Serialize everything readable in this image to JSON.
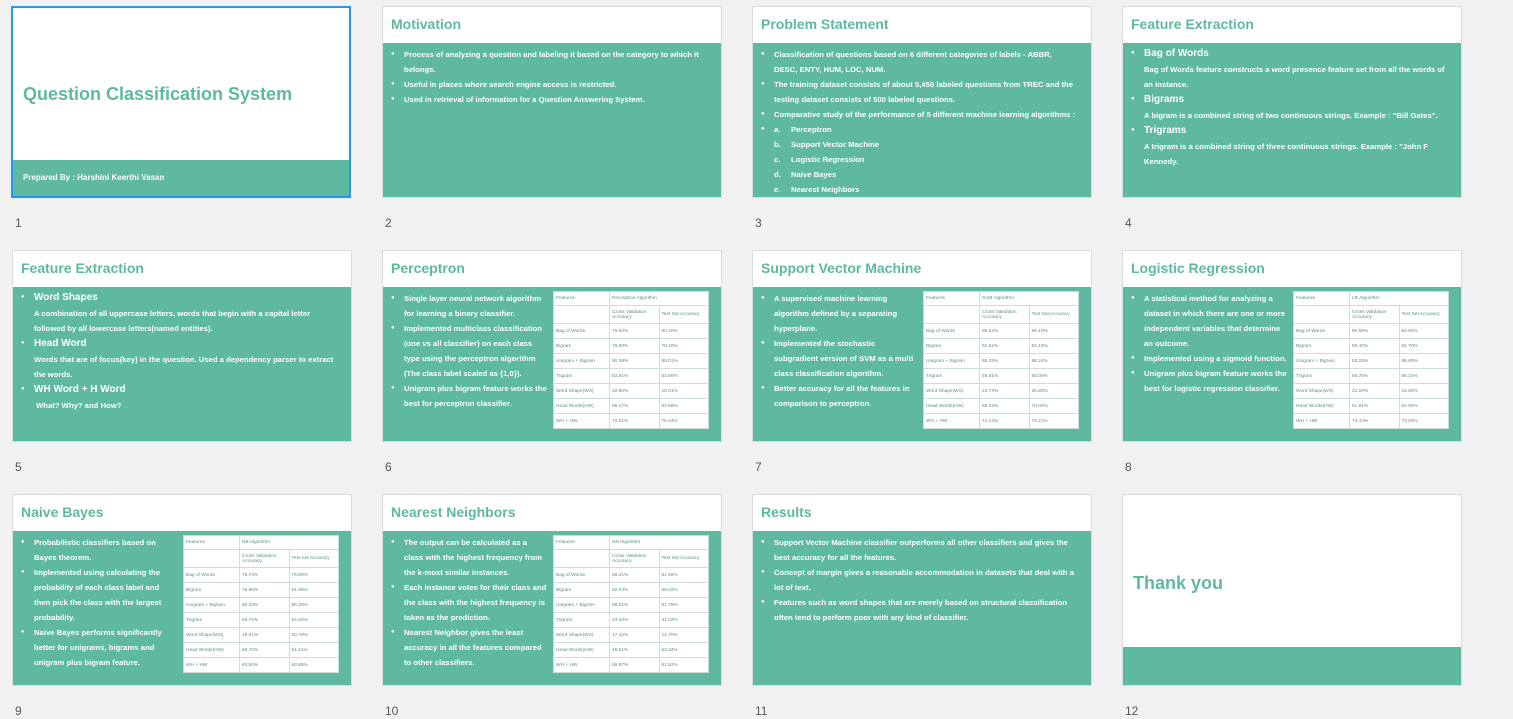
{
  "slides": [
    {
      "number": "1",
      "title": "Question Classification System",
      "author": "Prepared By : Harshini Keerthi Vasan"
    },
    {
      "number": "2",
      "title": "Motivation",
      "bullets": [
        "Process of analyzing a question and labeling it based on the category to which it belongs.",
        "Useful in places where search engine access is restricted.",
        "Used in retrieval of information for a Question Answering System."
      ]
    },
    {
      "number": "3",
      "title": "Problem Statement",
      "bullets": [
        "Classification of questions based on 6 different categories of labels - ABBR, DESC, ENTY, HUM, LOC, NUM.",
        "The training dataset consists of about 5,450 labeled questions from TREC and the testing dataset consists of 500 labeled questions.",
        "Comparative study of the performance of 5 different machine learning algorithms :"
      ],
      "algorithms": [
        {
          "letter": "a.",
          "name": "Perceptron"
        },
        {
          "letter": "b.",
          "name": "Support Vector Machine"
        },
        {
          "letter": "c.",
          "name": "Logistic Regression"
        },
        {
          "letter": "d.",
          "name": "Naive Bayes"
        },
        {
          "letter": "e.",
          "name": "Nearest Neighbors"
        }
      ]
    },
    {
      "number": "4",
      "title": "Feature Extraction",
      "features": [
        {
          "head": "Bag of Words",
          "desc": "Bag of Words feature constructs a word presence feature set from all the words of an instance."
        },
        {
          "head": "Bigrams",
          "desc": "A bigram is a combined string of two continuous strings. Example : \"Bill Gates\"."
        },
        {
          "head": "Trigrams",
          "desc": "A trigram is a combined string of three continuous strings. Example : \"John F Kennedy."
        }
      ]
    },
    {
      "number": "5",
      "title": "Feature Extraction",
      "features": [
        {
          "head": "Word Shapes",
          "desc": "A combination of all uppercase letters, words that begin with a capital letter followed by all lowercase letters(named entities)."
        },
        {
          "head": "Head Word",
          "desc": "Words that are of focus(key) in the question. Used a dependency parser to extract the words."
        },
        {
          "head": "WH Word + H Word",
          "desc": "What? Why? and How?"
        }
      ]
    },
    {
      "number": "6",
      "title": "Perceptron",
      "bullets": [
        "Single layer neural network algorithm for learning a binary classifier.",
        "Implemented multiclass classification (one vs all classifier) on each class type using the perceptron algorithm (The class label scaled as {1,0}).",
        "Unigram plus bigram feature works the best for perceptron classifier."
      ],
      "table": {
        "algo": "Perceptron Algorithm",
        "rows": [
          [
            "Bag of Words",
            "76.50%",
            "80.20%"
          ],
          [
            "Bigram",
            "76.80%",
            "78.40%"
          ],
          [
            "Unigram + Bigram",
            "80.39%",
            "85.01%"
          ],
          [
            "Trigram",
            "53.81%",
            "54.80%"
          ],
          [
            "Word Shape(WS)",
            "22.90%",
            "18.01%"
          ],
          [
            "Head Words(HW)",
            "68.17%",
            "63.68%"
          ],
          [
            "WH + HW",
            "72.01%",
            "75.24%"
          ]
        ]
      }
    },
    {
      "number": "7",
      "title": "Support Vector Machine",
      "bullets": [
        "A supervised machine learning algorithm defined by a separating hyperplane.",
        "Implemented the stochastic subgradient version of SVM as a multi class classification algorithm.",
        "Better accuracy for all the features in comparison to perceptron."
      ],
      "table": {
        "algo": "SVM Algorithm",
        "rows": [
          [
            "Bag of Words",
            "86.52%",
            "86.10%"
          ],
          [
            "Bigram",
            "81.62%",
            "84.10%"
          ],
          [
            "Unigram + Bigram",
            "86.25%",
            "88.24%"
          ],
          [
            "Trigram",
            "58.91%",
            "58.00%"
          ],
          [
            "Word Shape(WS)",
            "23.73%",
            "25.80%"
          ],
          [
            "Head Words(HW)",
            "68.34%",
            "70.00%"
          ],
          [
            "WH + HW",
            "74.12%",
            "76.21%"
          ]
        ]
      }
    },
    {
      "number": "8",
      "title": "Logistic Regression",
      "bullets": [
        "A statistical method for analyzing a dataset in which there are one or more independent variables that determine an outcome.",
        "Implemented using a sigmoid function.",
        "Unigram plus bigram feature works the best for logistic regression classifier."
      ],
      "table": {
        "algo": "LR Algorithm",
        "rows": [
          [
            "Bag of Words",
            "80.88%",
            "84.60%"
          ],
          [
            "Bigram",
            "80.40%",
            "81.70%"
          ],
          [
            "Unigram + Bigram",
            "83.03%",
            "86.80%"
          ],
          [
            "Trigram",
            "56.70%",
            "56.31%"
          ],
          [
            "Word Shape(WS)",
            "21.50%",
            "18.50%"
          ],
          [
            "Head Words(HW)",
            "61.91%",
            "62.60%"
          ],
          [
            "WH + HW",
            "73.43%",
            "73.60%"
          ]
        ]
      }
    },
    {
      "number": "9",
      "title": "Naive Bayes",
      "bullets": [
        "Probabilistic classifiers based on Bayes theorem.",
        "Implemented using calculating the probability of each class label and then pick the class with the largest probability.",
        "Naive Bayes performs significantly better for unigrams, bigrams and unigram plus bigram feature."
      ],
      "table": {
        "algo": "NB Algorithm",
        "rows": [
          [
            "Bag of Words",
            "75.70%",
            "76.80%"
          ],
          [
            "Bigram",
            "76.80%",
            "81.45%"
          ],
          [
            "Unigram + Bigram",
            "80.33%",
            "86.20%"
          ],
          [
            "Trigram",
            "53.70%",
            "54.60%"
          ],
          [
            "Word Shape(WS)",
            "18.61%",
            "20.70%"
          ],
          [
            "Head Words(HW)",
            "58.70%",
            "61.41%"
          ],
          [
            "WH + HW",
            "63.50%",
            "63.85%"
          ]
        ]
      }
    },
    {
      "number": "10",
      "title": "Nearest Neighbors",
      "bullets": [
        "The output can be calculated as a class with the highest frequency from the k-most similar instances.",
        "Each instance votes for their class and the class with the highest frequency is taken as the prediction.",
        "Nearest Neighbor gives the least accuracy in all the features compared to other classifiers."
      ],
      "table": {
        "algo": "NN Algorithm",
        "rows": [
          [
            "Bag of Words",
            "58.31%",
            "61.56%"
          ],
          [
            "Bigram",
            "52.03%",
            "56.02%"
          ],
          [
            "Unigram + Bigram",
            "58.01%",
            "61.79%"
          ],
          [
            "Trigram",
            "43.40%",
            "47.02%"
          ],
          [
            "Word Shape(WS)",
            "17.42%",
            "14.70%"
          ],
          [
            "Head Words(HW)",
            "48.01%",
            "53.34%"
          ],
          [
            "WH + HW",
            "58.97%",
            "61.92%"
          ]
        ]
      }
    },
    {
      "number": "11",
      "title": "Results",
      "bullets": [
        "Support Vector Machine classifier outperforms all other classifiers and gives the best accuracy for all the features.",
        "Concept of margin gives a reasonable accommodation in datasets that deal with a lot of text.",
        "Features such as word shapes that are merely based on structural classification often tend to perform poor with any kind of classifier."
      ]
    },
    {
      "number": "12",
      "title": "Thank you"
    }
  ],
  "table_headers": {
    "features": "Features",
    "cv": "Cross Validation Accuracy",
    "test": "Test Set Accuracy"
  },
  "colors": {
    "accent": "#5fb8a0",
    "selection": "#2196f3",
    "background": "#f1f1f1"
  }
}
